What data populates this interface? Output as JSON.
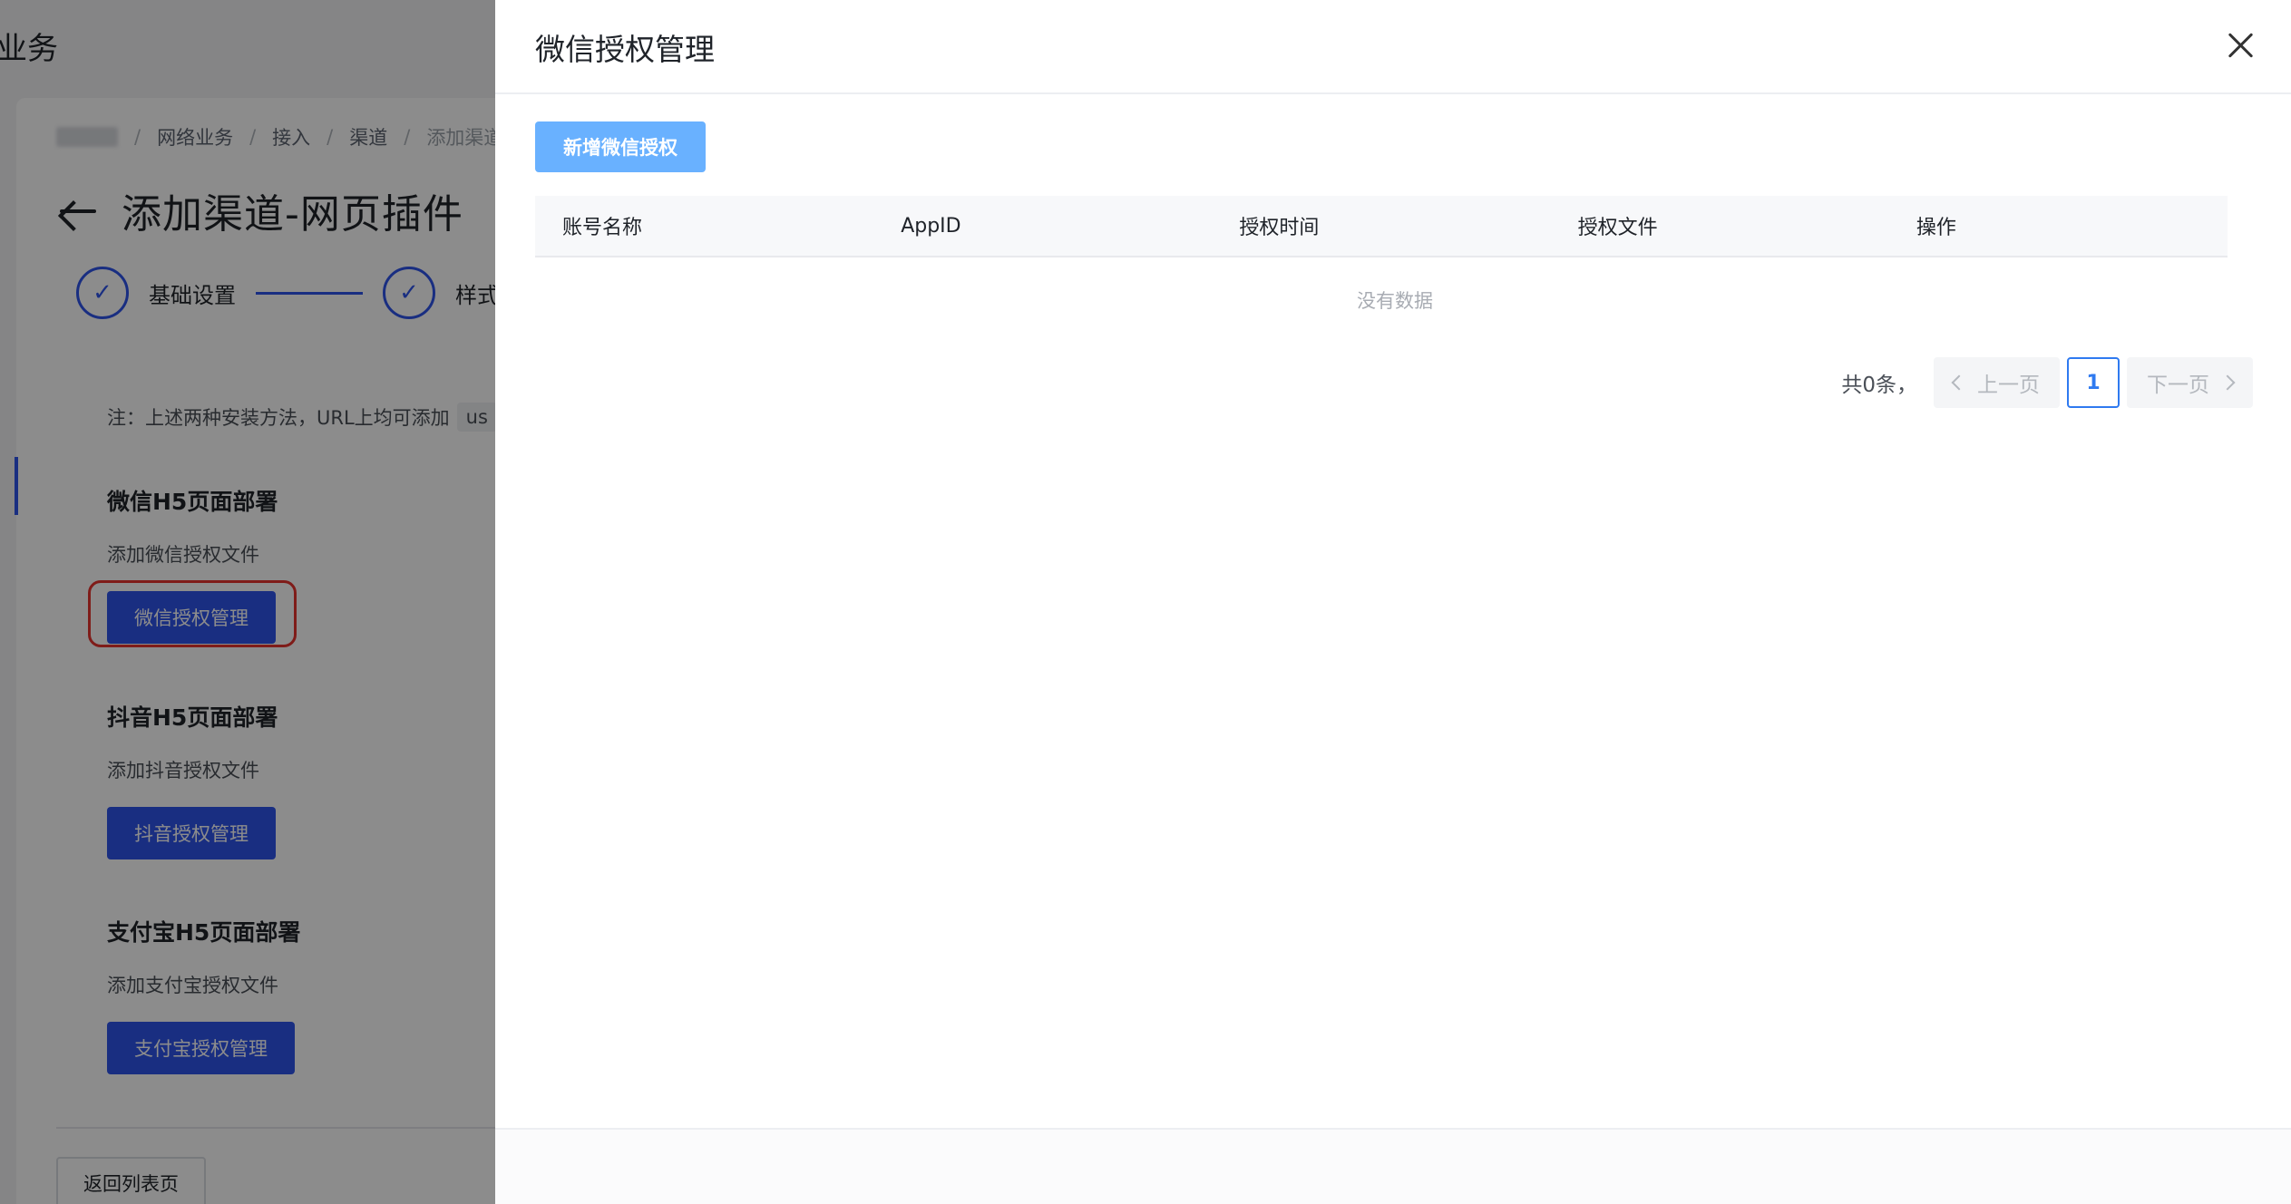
{
  "app": {
    "title": "业务"
  },
  "breadcrumb": {
    "items": [
      "网络业务",
      "接入",
      "渠道",
      "添加渠道-"
    ],
    "separator": "/"
  },
  "page": {
    "title": "添加渠道-网页插件",
    "steps": [
      {
        "label": "基础设置",
        "status": "done"
      },
      {
        "label": "样式",
        "status": "done"
      }
    ],
    "note": "注：上述两种安装方法，URL上均可添加",
    "note_code": "us",
    "sections": [
      {
        "title": "微信H5页面部署",
        "desc": "添加微信授权文件",
        "button": "微信授权管理"
      },
      {
        "title": "抖音H5页面部署",
        "desc": "添加抖音授权文件",
        "button": "抖音授权管理"
      },
      {
        "title": "支付宝H5页面部署",
        "desc": "添加支付宝授权文件",
        "button": "支付宝授权管理"
      }
    ],
    "back_button": "返回列表页"
  },
  "drawer": {
    "title": "微信授权管理",
    "add_button": "新增微信授权",
    "columns": [
      "账号名称",
      "AppID",
      "授权时间",
      "授权文件",
      "操作"
    ],
    "empty_text": "没有数据",
    "pagination": {
      "total_text": "共0条，",
      "prev": "上一页",
      "next": "下一页",
      "current": "1"
    }
  },
  "colors": {
    "primary": "#2f54eb",
    "add_button": "#69b1ff",
    "highlight": "#e8332e"
  }
}
